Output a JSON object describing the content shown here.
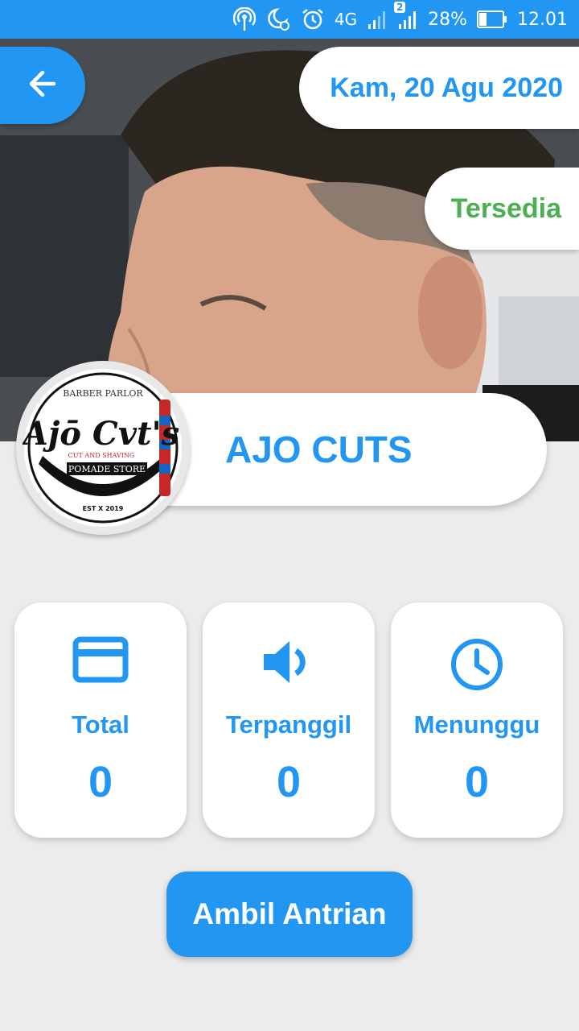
{
  "status_bar": {
    "network": "4G",
    "sim_badge": "2",
    "battery_percent": "28%",
    "time": "12.01",
    "icons": [
      "hotspot-icon",
      "dnd-moon-icon",
      "alarm-icon",
      "signal-1-icon",
      "signal-2-icon",
      "battery-icon"
    ]
  },
  "header": {
    "date": "Kam, 20 Agu 2020",
    "availability": "Tersedia",
    "shop_name": "AJO CUTS",
    "logo": {
      "main_text": "Ajō Cvt's",
      "top_text": "BARBER PARLOR",
      "sub_text": "CUT AND SHAVING",
      "banner_text": "POMADE STORE",
      "est_text": "EST X 2019"
    }
  },
  "stats": [
    {
      "icon": "credit-card-icon",
      "label": "Total",
      "value": "0"
    },
    {
      "icon": "speaker-icon",
      "label": "Terpanggil",
      "value": "0"
    },
    {
      "icon": "clock-icon",
      "label": "Menunggu",
      "value": "0"
    }
  ],
  "actions": {
    "take_queue_label": "Ambil Antrian"
  },
  "colors": {
    "primary": "#2196f3",
    "available": "#4caf50",
    "background": "#ececec",
    "card": "#ffffff"
  }
}
